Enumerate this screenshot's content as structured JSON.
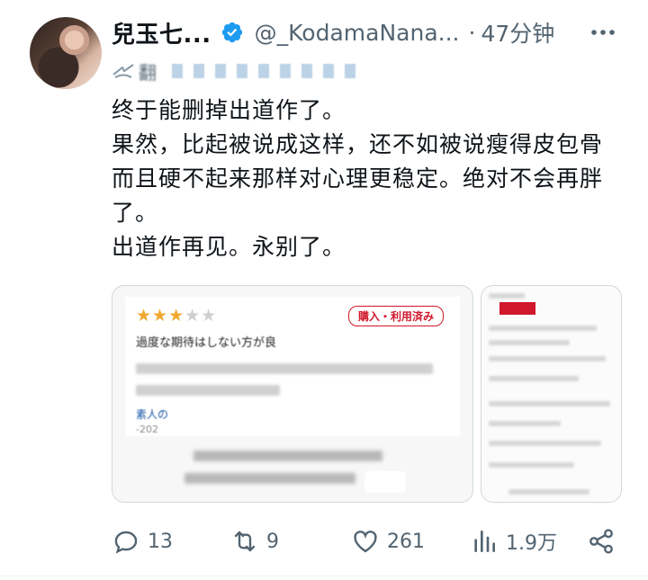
{
  "author": {
    "display_name": "兒玉七...",
    "handle": "@_KodamaNana...",
    "time_sep": "·",
    "time": "47分钟"
  },
  "translate": {
    "label": "翻"
  },
  "tweet": {
    "text": "终于能删掉出道作了。\n果然，比起被说成这样，还不如被说瘦得皮包骨而且硬不起来那样对心理更稳定。绝对不会再胖了。\n出道作再见。永别了。"
  },
  "card": {
    "stars_filled": 3,
    "stars_total": 5,
    "badge": "購入・利用済み",
    "review_title": "過度な期待はしない方が良",
    "reviewer": "素人の",
    "date": "-202"
  },
  "actions": {
    "reply_count": "13",
    "retweet_count": "9",
    "like_count": "261",
    "views_count": "1.9万"
  },
  "colors": {
    "verified": "#1d9bf0",
    "muted": "#536471",
    "star": "#f0a830",
    "badge": "#d1172b"
  },
  "icons": [
    "verified-icon",
    "more-icon",
    "translate-icon",
    "reply-icon",
    "retweet-icon",
    "like-icon",
    "views-icon",
    "share-icon"
  ]
}
